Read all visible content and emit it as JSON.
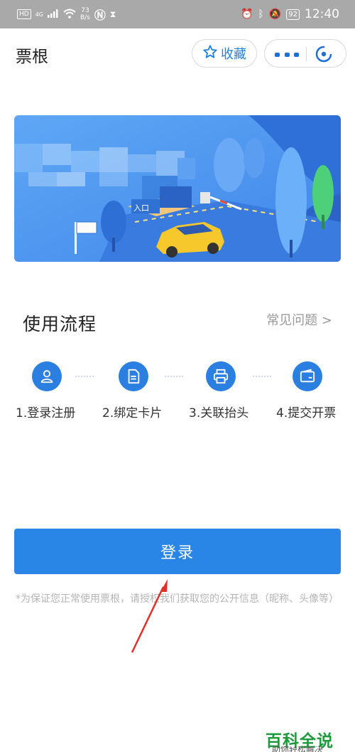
{
  "status_bar": {
    "hd": "HD",
    "signal": "4G",
    "speed_value": "73",
    "speed_unit": "B/s",
    "battery": "92",
    "time": "12:40"
  },
  "header": {
    "title": "票根",
    "favorite_label": "收藏"
  },
  "banner": {
    "entrance_sign": "入口"
  },
  "process": {
    "title": "使用流程",
    "faq_link": "常见问题 >",
    "steps": [
      {
        "label": "1.登录注册",
        "icon": "user-icon"
      },
      {
        "label": "2.绑定卡片",
        "icon": "document-icon"
      },
      {
        "label": "3.关联抬头",
        "icon": "printer-icon"
      },
      {
        "label": "4.提交开票",
        "icon": "wallet-icon"
      }
    ]
  },
  "login": {
    "button_label": "登录",
    "notice": "*为保证您正常使用票根，请授权我们获取您的公开信息（昵称、头像等）"
  },
  "watermark": {
    "brand": "百科全说",
    "tagline": "助你轻松解决"
  },
  "colors": {
    "accent": "#2a86e6",
    "status_bar": "#a9a9a9",
    "watermark_green": "#1d9b3a",
    "annotation_arrow": "#e0302a"
  }
}
